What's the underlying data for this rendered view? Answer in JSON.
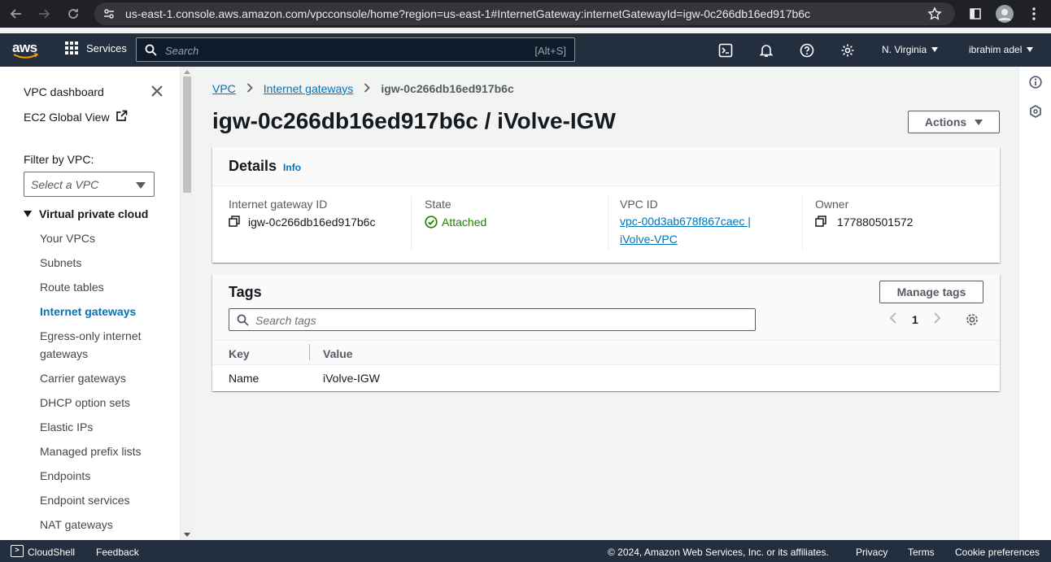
{
  "browser": {
    "url": "us-east-1.console.aws.amazon.com/vpcconsole/home?region=us-east-1#InternetGateway:internetGatewayId=igw-0c266db16ed917b6c"
  },
  "topnav": {
    "logo": "aws",
    "services": "Services",
    "search_placeholder": "Search",
    "search_shortcut": "[Alt+S]",
    "region": "N. Virginia",
    "user": "ibrahim adel"
  },
  "sidebar": {
    "dashboard": "VPC dashboard",
    "global_view": "EC2 Global View",
    "filter_label": "Filter by VPC:",
    "filter_placeholder": "Select a VPC",
    "section": "Virtual private cloud",
    "items": [
      {
        "label": "Your VPCs"
      },
      {
        "label": "Subnets"
      },
      {
        "label": "Route tables"
      },
      {
        "label": "Internet gateways"
      },
      {
        "label": "Egress-only internet gateways"
      },
      {
        "label": "Carrier gateways"
      },
      {
        "label": "DHCP option sets"
      },
      {
        "label": "Elastic IPs"
      },
      {
        "label": "Managed prefix lists"
      },
      {
        "label": "Endpoints"
      },
      {
        "label": "Endpoint services"
      },
      {
        "label": "NAT gateways"
      }
    ]
  },
  "breadcrumb": {
    "root": "VPC",
    "parent": "Internet gateways",
    "current": "igw-0c266db16ed917b6c"
  },
  "page": {
    "title": "igw-0c266db16ed917b6c / iVolve-IGW",
    "actions": "Actions"
  },
  "details": {
    "title": "Details",
    "info": "Info",
    "igw_label": "Internet gateway ID",
    "igw_value": "igw-0c266db16ed917b6c",
    "state_label": "State",
    "state_value": "Attached",
    "vpc_label": "VPC ID",
    "vpc_value": "vpc-00d3ab678f867caec | iVolve-VPC",
    "owner_label": "Owner",
    "owner_value": "177880501572"
  },
  "tags": {
    "title": "Tags",
    "manage": "Manage tags",
    "search_placeholder": "Search tags",
    "page": "1",
    "columns": [
      "Key",
      "Value"
    ],
    "rows": [
      {
        "key": "Name",
        "value": "iVolve-IGW"
      }
    ]
  },
  "footer": {
    "cloudshell": "CloudShell",
    "feedback": "Feedback",
    "copyright": "© 2024, Amazon Web Services, Inc. or its affiliates.",
    "privacy": "Privacy",
    "terms": "Terms",
    "cookies": "Cookie preferences"
  },
  "colors": {
    "aws_nav": "#232f3e",
    "link": "#0073bb",
    "success": "#1d8102",
    "aws_orange": "#ff9900"
  }
}
